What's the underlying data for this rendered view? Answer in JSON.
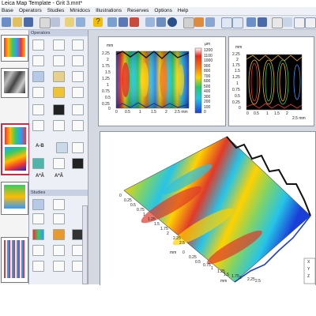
{
  "window": {
    "title": "Leica Map Template - Grit 3.mnt*"
  },
  "menu": [
    {
      "label": "Base"
    },
    {
      "label": "Operators"
    },
    {
      "label": "Studies"
    },
    {
      "label": "Minidocs"
    },
    {
      "label": "Illustrations"
    },
    {
      "label": "Reserves"
    },
    {
      "label": "Options"
    },
    {
      "label": "Help"
    }
  ],
  "panels": {
    "operators": "Operators",
    "studies": "Studies"
  },
  "operator_labels": {
    "ab": "A-B",
    "axa1": "A*Â",
    "axa2": "A*Â"
  },
  "map2d": {
    "x_ticks": [
      "0",
      "0.5",
      "1",
      "1.5",
      "2",
      "2.5 mm"
    ],
    "y_unit": "mm",
    "y_ticks": [
      "2.25",
      "2",
      "1.75",
      "1.5",
      "1.25",
      "1",
      "0.75",
      "0.5",
      "0.25",
      "0"
    ],
    "scale_unit": "µm",
    "scale_ticks": [
      "1200",
      "1100",
      "1000",
      "900",
      "800",
      "700",
      "600",
      "500",
      "400",
      "300",
      "200",
      "100",
      "0"
    ]
  },
  "contour": {
    "y_unit": "mm",
    "y_ticks": [
      "2.25",
      "2",
      "1.75",
      "1.5",
      "1.25",
      "1",
      "0.75",
      "0.5",
      "0.25",
      "0"
    ],
    "x_ticks": [
      "0",
      "0.5",
      "1",
      "1.5",
      "2",
      "2.5 mm"
    ]
  },
  "view3d": {
    "x_ticks": [
      "0",
      "0.25",
      "0.5",
      "0.75",
      "1",
      "1.25",
      "1.5",
      "1.75",
      "2",
      "2.25",
      "2.5"
    ],
    "y_unit": "mm",
    "y_ticks": [
      "0",
      "0.25",
      "0.5",
      "0.75",
      "1",
      "1.25",
      "1.5",
      "1.75",
      "2",
      "2.25",
      "2.5"
    ],
    "x_unit": "mm",
    "axis_labels": [
      "X",
      "Y",
      "Z"
    ]
  }
}
